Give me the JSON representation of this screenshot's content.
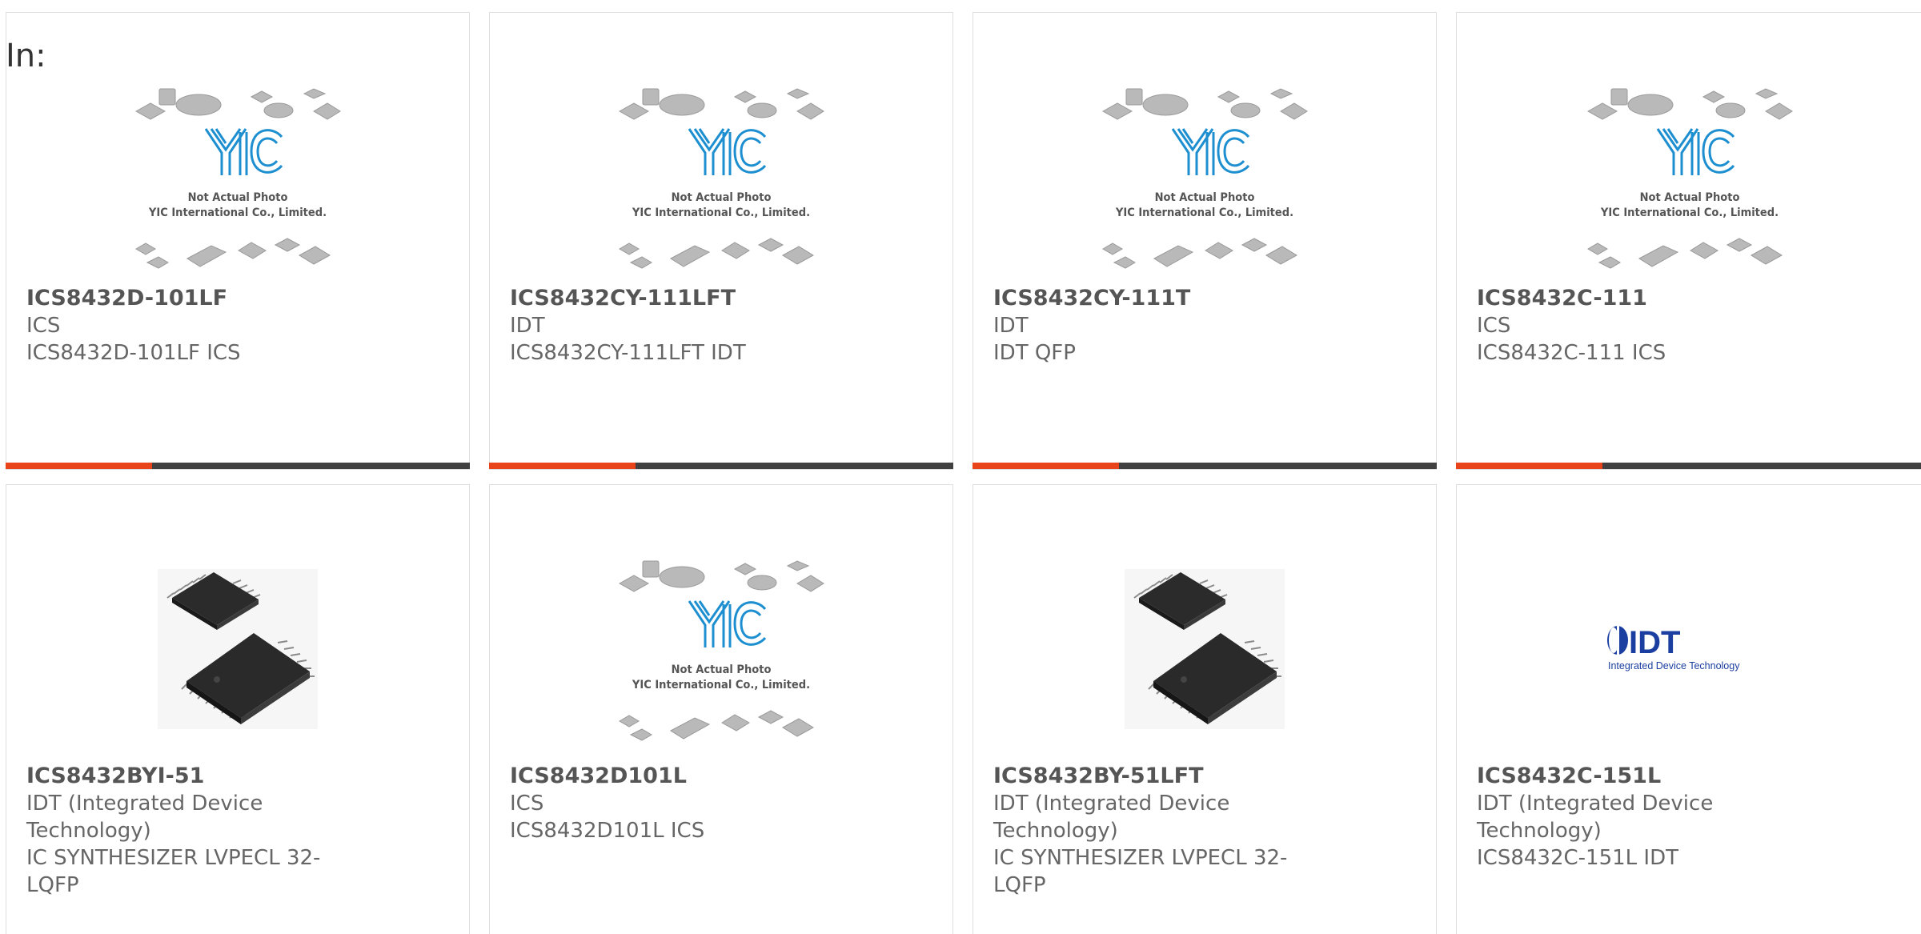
{
  "page": {
    "label": "In:"
  },
  "colors": {
    "accent_bar": "#e8431a",
    "bar": "#404040",
    "border": "#dedede",
    "yic_blue": "#1d8fd0",
    "idt_blue": "#1b3fa0"
  },
  "products": [
    {
      "part": "ICS8432D-101LF",
      "maker": "ICS",
      "desc": "ICS8432D-101LF ICS",
      "image": "yic-placeholder"
    },
    {
      "part": "ICS8432CY-111LFT",
      "maker": "IDT",
      "desc": "ICS8432CY-111LFT IDT",
      "image": "yic-placeholder"
    },
    {
      "part": "ICS8432CY-111T",
      "maker": "IDT",
      "desc": "IDT QFP",
      "image": "yic-placeholder"
    },
    {
      "part": "ICS8432C-111",
      "maker": "ICS",
      "desc": "ICS8432C-111 ICS",
      "image": "yic-placeholder"
    },
    {
      "part": "ICS8432BYI-51",
      "maker": "IDT (Integrated Device Technology)",
      "desc": "IC SYNTHESIZER LVPECL 32-LQFP",
      "image": "lqfp-chip"
    },
    {
      "part": "ICS8432D101L",
      "maker": "ICS",
      "desc": "ICS8432D101L ICS",
      "image": "yic-placeholder"
    },
    {
      "part": "ICS8432BY-51LFT",
      "maker": "IDT (Integrated Device Technology)",
      "desc": "IC SYNTHESIZER LVPECL 32-LQFP",
      "image": "lqfp-chip"
    },
    {
      "part": "ICS8432C-151L",
      "maker": "IDT (Integrated Device Technology)",
      "desc": "ICS8432C-151L IDT",
      "image": "idt-logo"
    }
  ],
  "placeholder": {
    "brand": "YIC",
    "line1": "Not Actual Photo",
    "line2": "YIC International Co., Limited."
  },
  "idt_logo": {
    "brand": "IDT",
    "tagline": "Integrated Device Technology"
  }
}
